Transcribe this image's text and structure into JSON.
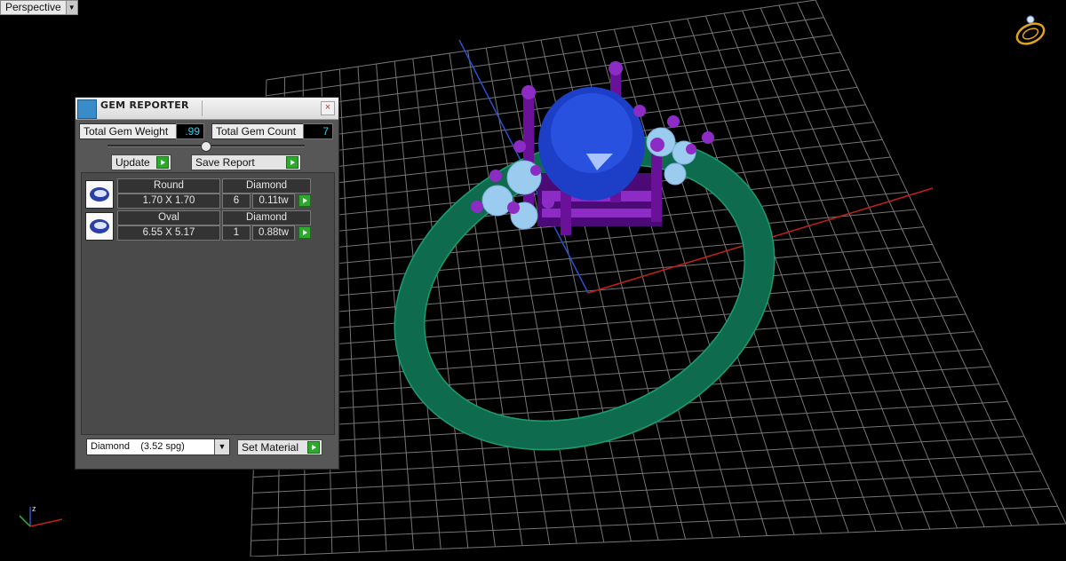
{
  "viewport": {
    "label": "Perspective"
  },
  "panel": {
    "title": "GEM REPORTER",
    "total_weight_label": "Total Gem Weight",
    "total_weight_value": ".99",
    "total_count_label": "Total Gem Count",
    "total_count_value": "7",
    "update_label": "Update",
    "save_report_label": "Save Report",
    "rows": [
      {
        "shape": "Round",
        "size": "1.70 X 1.70",
        "material": "Diamond",
        "count": "6",
        "weight": "0.11tw"
      },
      {
        "shape": "Oval",
        "size": "6.55 X 5.17",
        "material": "Diamond",
        "count": "1",
        "weight": "0.88tw"
      }
    ],
    "material_select": "Diamond    (3.52 spg)",
    "set_material_label": "Set Material"
  },
  "colors": {
    "axis_x": "#c0201d",
    "axis_y": "#2950d0",
    "band": "#0e6b4e",
    "prongs": "#6a119a",
    "center_stone": "#1d3fc8",
    "side_stones": "#9ccbf0",
    "value_text": "#33d1e8"
  },
  "icons": {
    "app": "gem-reporter-icon",
    "close": "close-icon",
    "corner": "ring-icon",
    "axes": "axis-triad-icon"
  }
}
